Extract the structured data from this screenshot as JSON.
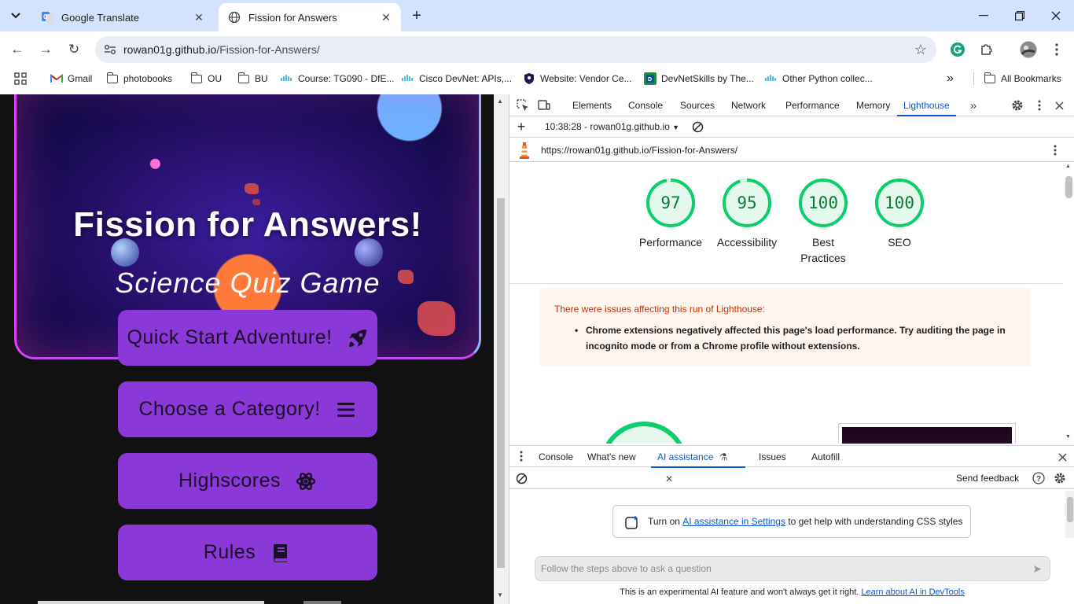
{
  "browser": {
    "tabs": [
      {
        "title": "Google Translate",
        "active": false
      },
      {
        "title": "Fission for Answers",
        "active": true
      }
    ],
    "url_host": "rowan01g.github.io",
    "url_path": "/Fission-for-Answers/",
    "bookmarks": [
      {
        "label": "Gmail",
        "icon": "gmail-icon"
      },
      {
        "label": "photobooks",
        "icon": "folder-icon"
      },
      {
        "label": "OU",
        "icon": "folder-icon"
      },
      {
        "label": "BU",
        "icon": "folder-icon"
      },
      {
        "label": "Course: TG090 - DfE...",
        "icon": "cisco-icon"
      },
      {
        "label": "Cisco DevNet: APIs,...",
        "icon": "cisco-icon"
      },
      {
        "label": "Website: Vendor Ce...",
        "icon": "shield-icon"
      },
      {
        "label": "DevNetSkills by The...",
        "icon": "devnet-icon"
      },
      {
        "label": "Other Python collec...",
        "icon": "cisco-icon"
      }
    ],
    "all_bookmarks": "All Bookmarks",
    "colors": {
      "chrome_bg": "#d3e3fd",
      "accent": "#0b57d0"
    }
  },
  "page": {
    "title": "Fission for Answers!",
    "subtitle": "Science Quiz Game",
    "buttons": [
      {
        "label": "Quick Start Adventure!",
        "icon": "rocket-icon"
      },
      {
        "label": "Choose a Category!",
        "icon": "menu-bars-icon"
      },
      {
        "label": "Highscores",
        "icon": "atom-icon"
      },
      {
        "label": "Rules",
        "icon": "book-icon"
      }
    ],
    "colors": {
      "button": "#8a38d8",
      "background": "#111111"
    }
  },
  "devtools": {
    "tabs": [
      "Elements",
      "Console",
      "Sources",
      "Network",
      "Performance",
      "Memory",
      "Lighthouse"
    ],
    "selected_tab": "Lighthouse",
    "report_selector": "10:38:28 - rowan01g.github.io",
    "report_url": "https://rowan01g.github.io/Fission-for-Answers/",
    "scores": [
      {
        "value": "97",
        "label": "Performance"
      },
      {
        "value": "95",
        "label": "Accessibility"
      },
      {
        "value": "100",
        "label": "Best Practices"
      },
      {
        "value": "100",
        "label": "SEO"
      }
    ],
    "warning": {
      "title": "There were issues affecting this run of Lighthouse:",
      "item": "Chrome extensions negatively affected this page's load performance. Try auditing the page in incognito mode or from a Chrome profile without extensions."
    },
    "drawer_tabs": [
      "Console",
      "What's new",
      "AI assistance",
      "Issues",
      "Autofill"
    ],
    "drawer_selected": "AI assistance",
    "send_feedback": "Send feedback",
    "ai_banner": {
      "prefix": "Turn on ",
      "link": "AI assistance in Settings",
      "suffix": " to get help with understanding CSS styles"
    },
    "ai_input_placeholder": "Follow the steps above to ask a question",
    "ai_footer": {
      "text": "This is an experimental AI feature and won't always get it right. ",
      "link": "Learn about AI in DevTools"
    },
    "colors": {
      "pass_green": "#0cce6b",
      "score_text": "#0a7c35",
      "warn_bg": "#fef5ef",
      "warn_title": "#c33300"
    }
  }
}
